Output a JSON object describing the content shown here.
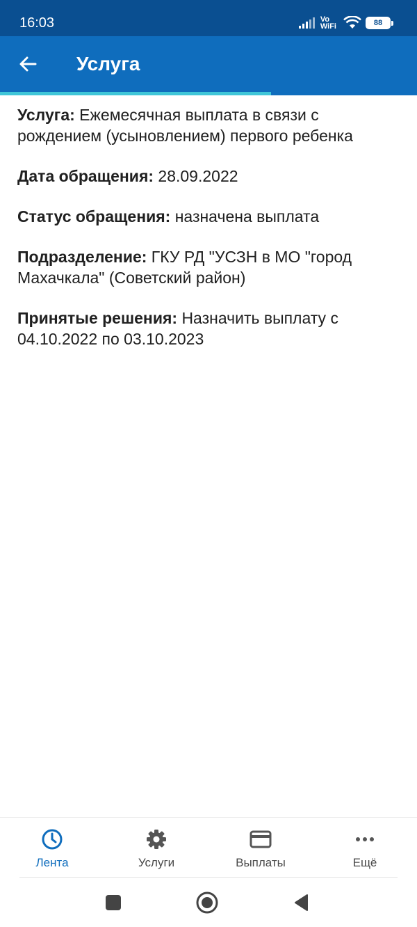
{
  "status_bar": {
    "time": "16:03",
    "vowifi_top": "Vo",
    "vowifi_bottom": "WiFi",
    "battery": "88"
  },
  "app_bar": {
    "title": "Услуга",
    "back_icon": "arrow-left-icon"
  },
  "fields": [
    {
      "label": "Услуга:",
      "value": "Ежемесячная выплата в связи с рождением (усыновлением) первого ребенка"
    },
    {
      "label": "Дата обращения:",
      "value": "28.09.2022"
    },
    {
      "label": "Статус обращения:",
      "value": "назначена выплата"
    },
    {
      "label": "Подразделение:",
      "value": "ГКУ РД \"УСЗН в МО \"город Махачкала\" (Советский район)"
    },
    {
      "label": "Принятые решения:",
      "value": "Назначить выплату с 04.10.2022 по 03.10.2023"
    }
  ],
  "bottom_nav": [
    {
      "label": "Лента",
      "icon": "clock-icon",
      "active": true
    },
    {
      "label": "Услуги",
      "icon": "gear-icon",
      "active": false
    },
    {
      "label": "Выплаты",
      "icon": "card-icon",
      "active": false
    },
    {
      "label": "Ещё",
      "icon": "more-dots-icon",
      "active": false
    }
  ],
  "colors": {
    "status_bar": "#0a4f91",
    "app_bar": "#0f6dbd",
    "accent_line": "#3fc6d8",
    "active_nav": "#0f6dbd"
  }
}
